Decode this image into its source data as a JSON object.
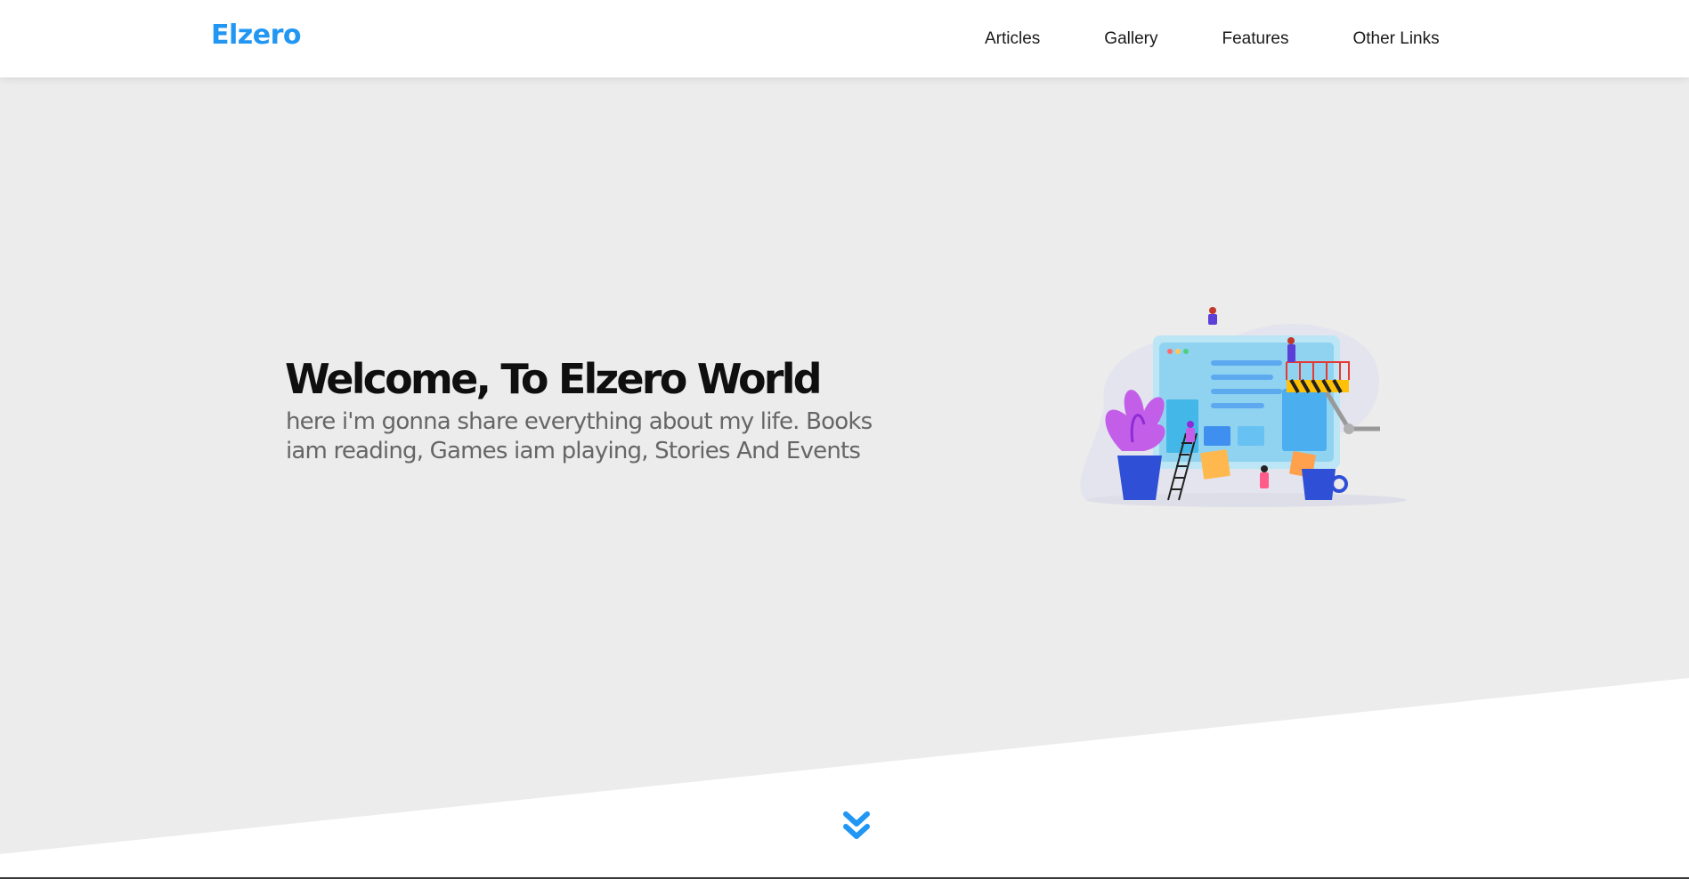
{
  "header": {
    "logo": "Elzero",
    "nav": [
      "Articles",
      "Gallery",
      "Features",
      "Other Links"
    ]
  },
  "landing": {
    "title": "Welcome, To Elzero World",
    "text": "here i'm gonna share everything about my life. Books iam reading, Games iam playing, Stories And Events"
  },
  "icons": {
    "go_down": "double-chevron-down-icon"
  },
  "colors": {
    "accent": "#2196f3",
    "landing_bg": "#ececec",
    "title": "#0f0f0f",
    "text": "#666666"
  }
}
